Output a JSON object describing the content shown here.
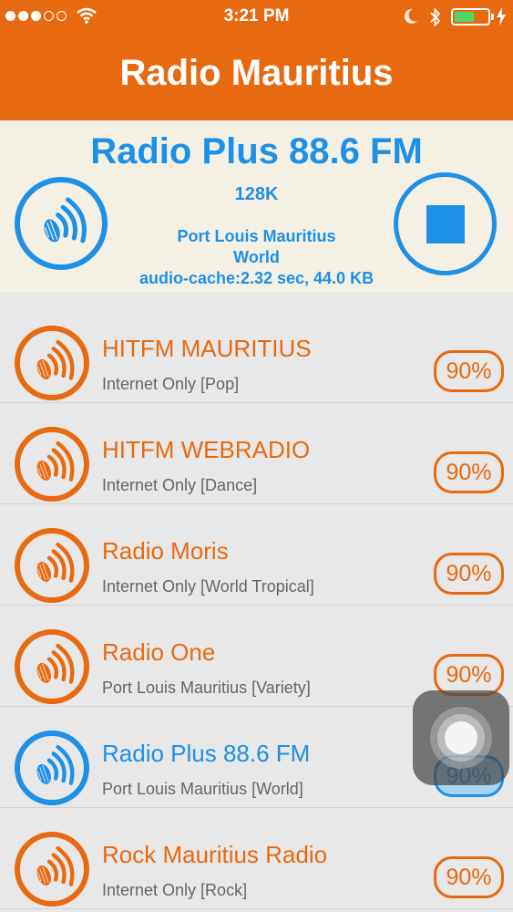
{
  "status_bar": {
    "time": "3:21 PM",
    "signal_filled": 3,
    "signal_total": 5,
    "battery_level": 0.6
  },
  "header": {
    "title": "Radio Mauritius"
  },
  "now_playing": {
    "station": "Radio Plus 88.6 FM",
    "bitrate": "128K",
    "location_line1": "Port Louis Mauritius",
    "location_line2": "World",
    "cache": "audio-cache:2.32 sec, 44.0 KB",
    "icon": "speaker-icon",
    "stop_icon": "stop-icon"
  },
  "stations": [
    {
      "name": "HITFM MAURITIUS",
      "subtitle": "Internet Only [Pop]",
      "badge": "90%",
      "active": false
    },
    {
      "name": "HITFM WEBRADIO",
      "subtitle": "Internet Only [Dance]",
      "badge": "90%",
      "active": false
    },
    {
      "name": "Radio Moris",
      "subtitle": "Internet Only [World Tropical]",
      "badge": "90%",
      "active": false
    },
    {
      "name": "Radio One",
      "subtitle": "Port Louis Mauritius [Variety]",
      "badge": "90%",
      "active": false
    },
    {
      "name": "Radio Plus 88.6 FM",
      "subtitle": "Port Louis Mauritius [World]",
      "badge": "90%",
      "active": true
    },
    {
      "name": "Rock Mauritius Radio",
      "subtitle": "Internet Only [Rock]",
      "badge": "90%",
      "active": false
    }
  ],
  "colors": {
    "accent": "#e86a10",
    "active": "#1e90e6",
    "player_bg": "#f4f1e4",
    "list_bg": "#e8e8e8"
  }
}
